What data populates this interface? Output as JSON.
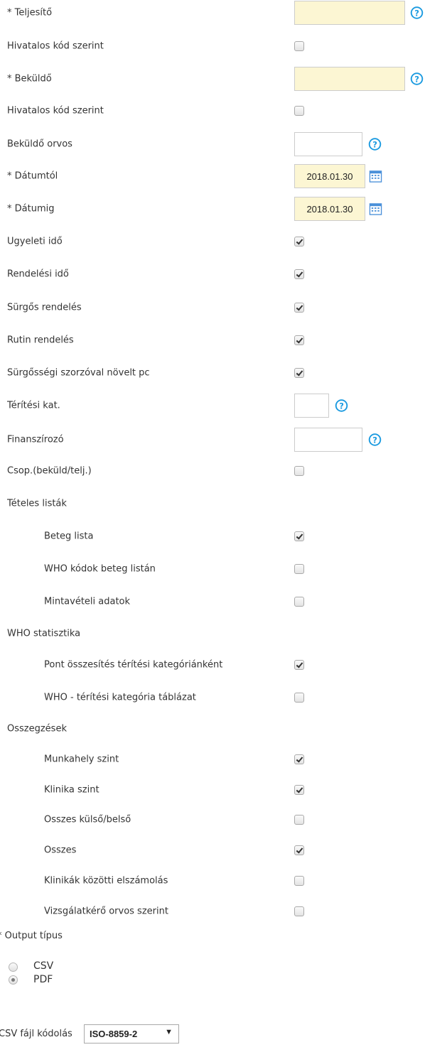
{
  "form": {
    "teljesito_label": "* Teljesítő",
    "teljesito_value": "",
    "hivatalos_kod_1_label": "Hivatalos kód szerint",
    "hivatalos_kod_1_checked": false,
    "bekuldo_label": "* Beküldő",
    "bekuldo_value": "",
    "hivatalos_kod_2_label": "Hivatalos kód szerint",
    "hivatalos_kod_2_checked": false,
    "bekuldo_orvos_label": "Beküldő orvos",
    "bekuldo_orvos_value": "",
    "datumtol_label": "* Dátumtól",
    "datumtol_value": "2018.01.30",
    "datumig_label": "* Dátumig",
    "datumig_value": "2018.01.30",
    "ugyeleti_ido_label": "Ügyeleti idő",
    "ugyeleti_ido_checked": true,
    "rendelesi_ido_label": "Rendelési idő",
    "rendelesi_ido_checked": true,
    "surgos_rendeles_label": "Sürgős rendelés",
    "surgos_rendeles_checked": true,
    "rutin_rendeles_label": "Rutin rendelés",
    "rutin_rendeles_checked": true,
    "surgossegi_szorzo_label": "Sürgősségi szorzóval növelt pc",
    "surgossegi_szorzo_checked": true,
    "teritesi_kat_label": "Térítési kat.",
    "teritesi_kat_value": "",
    "finanszirozo_label": "Finanszírozó",
    "finanszirozo_value": "",
    "csop_label": "Csop.(beküld/telj.)",
    "csop_checked": false
  },
  "teteles_listak": {
    "heading": "Tételes listák",
    "items": [
      {
        "label": "Beteg lista",
        "checked": true
      },
      {
        "label": "WHO kódok beteg listán",
        "checked": false
      },
      {
        "label": "Mintavételi adatok",
        "checked": false
      }
    ]
  },
  "who_statisztika": {
    "heading": "WHO statisztika",
    "items": [
      {
        "label": "Pont összesítés térítési kategóriánként",
        "checked": true
      },
      {
        "label": "WHO - térítési kategória táblázat",
        "checked": false
      }
    ]
  },
  "osszegzesek": {
    "heading": "Összegzések",
    "items": [
      {
        "label": "Munkahely szint",
        "checked": true
      },
      {
        "label": "Klinika szint",
        "checked": true
      },
      {
        "label": "Összes külső/belső",
        "checked": false
      },
      {
        "label": "Összes",
        "checked": true
      },
      {
        "label": "Klinikák közötti elszámolás",
        "checked": false
      },
      {
        "label": "Vizsgálatkérő orvos szerint",
        "checked": false
      }
    ]
  },
  "output": {
    "label": "* Output típus",
    "options": [
      {
        "label": "CSV",
        "selected": false
      },
      {
        "label": "PDF",
        "selected": true
      }
    ]
  },
  "csv_encoding": {
    "label": "CSV fájl kódolás",
    "selected": "ISO-8859-2",
    "arrow": "▼"
  },
  "icons": {
    "help": "help-icon",
    "calendar": "calendar-icon"
  },
  "colors": {
    "required_field_bg": "#fcf6d3",
    "help_icon": "#1a9ae0",
    "calendar_icon": "#4a90d9"
  }
}
